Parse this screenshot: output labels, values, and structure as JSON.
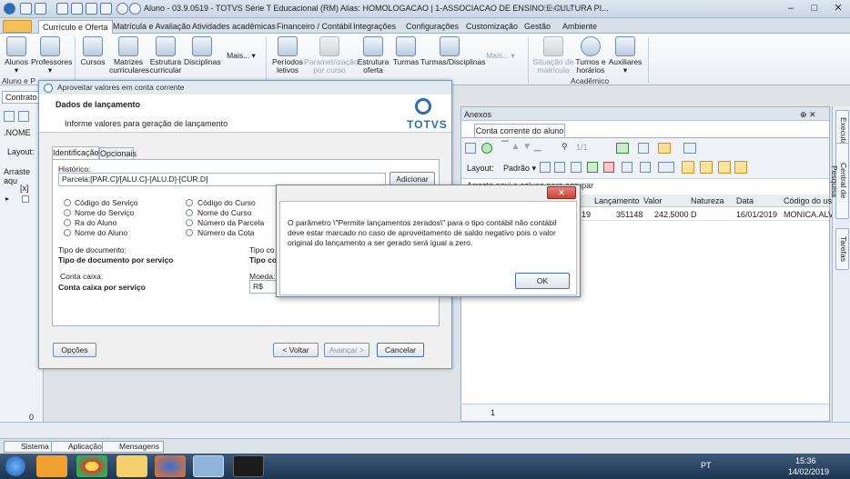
{
  "titlebar": {
    "title": "Aluno - 03.9.0519 - TOTVS Série T Educacional (RM) Alias: HOMOLOGACAO | 1-ASSOCIACAO DE ENSINO E CULTURA PI...",
    "center": "Sistema",
    "minimize": "–",
    "maximize": "□",
    "close": "✕"
  },
  "ribbon_tabs": [
    "Currículo e Oferta",
    "Matrícula e Avaliação",
    "Atividades acadêmicas",
    "Financeiro / Contábil",
    "Integrações",
    "Configurações",
    "Customização",
    "Gestão",
    "Ambiente"
  ],
  "ribbon_buttons": [
    {
      "label": "Alunos\n▾",
      "icon": "student-icon"
    },
    {
      "label": "Professores\n▾",
      "icon": "teacher-icon"
    },
    {
      "label": "Cursos",
      "icon": "course-icon"
    },
    {
      "label": "Matrizes\ncurriculares",
      "icon": "matrix-icon"
    },
    {
      "label": "Estrutura\ncurricular",
      "icon": "structure-icon"
    },
    {
      "label": "Disciplinas",
      "icon": "discipline-icon"
    },
    {
      "label": "Mais...",
      "icon": ""
    },
    {
      "label": "Períodos\nletivos",
      "icon": "period-icon"
    },
    {
      "label": "Parametrização\npor curso",
      "icon": "gear-icon",
      "disabled": true
    },
    {
      "label": "Estrutura\noferta",
      "icon": "offer-icon"
    },
    {
      "label": "Turmas",
      "icon": "class-icon"
    },
    {
      "label": "Turmas/Disciplinas",
      "icon": "class-discipline-icon"
    },
    {
      "label": "Mais...",
      "icon": "",
      "disabled": true
    },
    {
      "label": "Situação de\nmatrícula",
      "icon": "status-icon",
      "disabled": true
    },
    {
      "label": "Turnos e\nhorários",
      "icon": "clock-icon"
    },
    {
      "label": "Auxiliares\n▾",
      "icon": "aux-icon"
    }
  ],
  "ribbon_groups": {
    "left": "Aluno e P",
    "academico": "Acadêmico"
  },
  "left_panel": {
    "tab": "Contrato",
    "layout": "Layout:",
    "name_col": ".NOME",
    "arraste": "Arraste aqu",
    "x_col": "[x]",
    "count": "0"
  },
  "anexos": {
    "title": "Anexos",
    "pin": "⊕ ✕",
    "tab": "Conta corrente do aluno",
    "layout": "Layout:",
    "padrao": "Padrão ▾",
    "page": "1/1",
    "group_hint": "Arraste aqui a coluna para agrupar",
    "columns": [
      "Lançamento",
      "Valor",
      "Natureza",
      "Data",
      "Código do usu"
    ],
    "row": {
      "pre": "19",
      "lancamento": "351148",
      "valor": "242,5000",
      "natureza": "D",
      "data": "16/01/2019",
      "usuario": "MONICA.ALVI"
    },
    "footer": "1"
  },
  "right_strip": [
    "Executar",
    "Central de Pesquisa",
    "Tarefas"
  ],
  "wizard": {
    "title": "Aproveitar valores em conta corrente",
    "heading": "Dados de lançamento",
    "subheading": "Informe valores para geração de lançamento",
    "logo": "TOTVS",
    "tabs": [
      "Identificação",
      "Opcionais"
    ],
    "historico_label": "Histórico:",
    "historico_value": "Parcela:[PAR.C]/[ALU.C]-[ALU.D]-[CUR.D]",
    "adicionar": "Adicionar",
    "radios_left": [
      "Código do Serviço",
      "Nome do Serviço",
      "Ra do Aluno",
      "Nome do Aluno"
    ],
    "radios_right": [
      "Código do Curso",
      "Nome do Curso",
      "Número da Parcela",
      "Número da Cota"
    ],
    "tipo_doc_label": "Tipo de documento:",
    "tipo_doc_value": "Tipo de documento por serviço",
    "tipo_co_label": "Tipo co",
    "tipo_co_value": "Tipo co",
    "conta_label": "Conta caixa:",
    "conta_value": "Conta caixa por serviço",
    "moeda_label": "Moeda:",
    "moeda_value": "R$",
    "opcoes": "Opções",
    "voltar": "< Voltar",
    "avancar": "Avançar >",
    "cancelar": "Cancelar"
  },
  "message": {
    "text": "O parâmetro \\\"Permite lançamentos zerados\\\" para o tipo contábil não contábil deve estar marcado no caso de aproveitamento de saldo negativo pois o valor original do lançamento a ser gerado será igual a zero.",
    "close": "✕",
    "ok": "OK"
  },
  "modules": [
    "Sistema",
    "Aplicação",
    "Mensagens"
  ],
  "taskbar": {
    "lang": "PT",
    "time": "15:36",
    "date": "14/02/2019"
  }
}
